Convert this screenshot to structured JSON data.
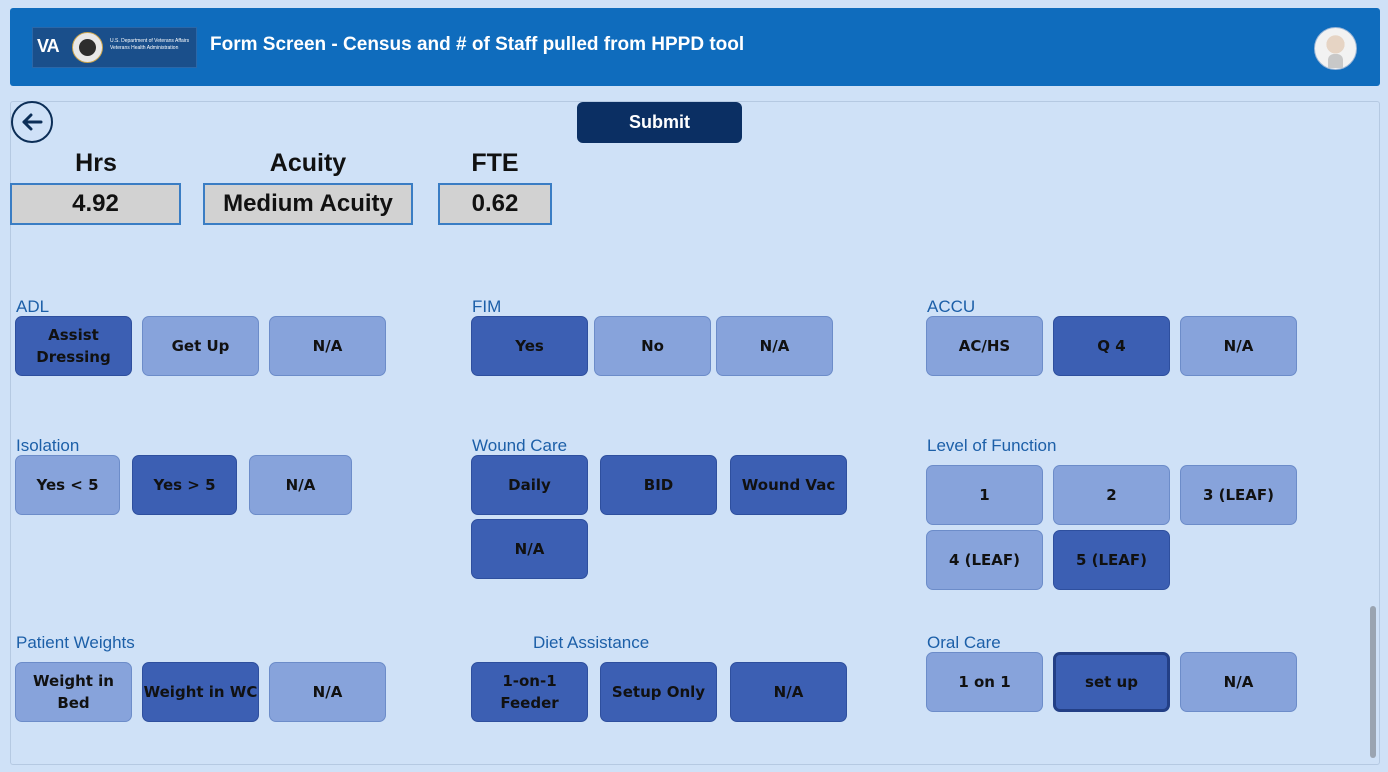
{
  "header": {
    "logo_text": "VA",
    "dept_line1": "U.S. Department of Veterans Affairs",
    "dept_line2": "Veterans Health Administration",
    "title": "Form Screen - Census and # of Staff pulled from HPPD tool"
  },
  "actions": {
    "submit": "Submit"
  },
  "stats": {
    "hrs_label": "Hrs",
    "hrs_value": "4.92",
    "acuity_label": "Acuity",
    "acuity_value": "Medium Acuity",
    "fte_label": "FTE",
    "fte_value": "0.62"
  },
  "sections": {
    "adl": {
      "label": "ADL",
      "options": [
        "Assist Dressing",
        "Get Up",
        "N/A"
      ],
      "selected": "Assist Dressing"
    },
    "fim": {
      "label": "FIM",
      "options": [
        "Yes",
        "No",
        "N/A"
      ],
      "selected": "Yes"
    },
    "accu": {
      "label": "ACCU",
      "options": [
        "AC/HS",
        "Q 4",
        "N/A"
      ],
      "selected": "Q 4"
    },
    "isolation": {
      "label": "Isolation",
      "options": [
        "Yes < 5",
        "Yes > 5",
        "N/A"
      ],
      "selected": "Yes > 5"
    },
    "wound_care": {
      "label": "Wound Care",
      "options": [
        "Daily",
        "BID",
        "Wound Vac",
        "N/A"
      ],
      "selected": [
        "Daily",
        "BID",
        "Wound Vac",
        "N/A"
      ]
    },
    "level_of_function": {
      "label": "Level of Function",
      "options": [
        "1",
        "2",
        "3 (LEAF)",
        "4 (LEAF)",
        "5 (LEAF)"
      ],
      "selected": "5 (LEAF)"
    },
    "patient_weights": {
      "label": "Patient Weights",
      "options": [
        "Weight in Bed",
        "Weight in WC",
        "N/A"
      ],
      "selected": "Weight in WC"
    },
    "diet_assistance": {
      "label": "Diet Assistance",
      "options": [
        "1-on-1 Feeder",
        "Setup Only",
        "N/A"
      ],
      "selected": [
        "1-on-1 Feeder",
        "Setup Only",
        "N/A"
      ]
    },
    "oral_care": {
      "label": "Oral Care",
      "options": [
        "1 on 1",
        "set up",
        "N/A"
      ],
      "selected": "set up"
    }
  },
  "colors": {
    "header_bg": "#0f6cbd",
    "page_bg": "#cfe1f7",
    "option_unselected": "#87a3db",
    "option_selected": "#3c5fb3",
    "submit_bg": "#0b2f63"
  },
  "icons": {
    "back": "arrow-left-icon",
    "avatar": "user-avatar"
  }
}
